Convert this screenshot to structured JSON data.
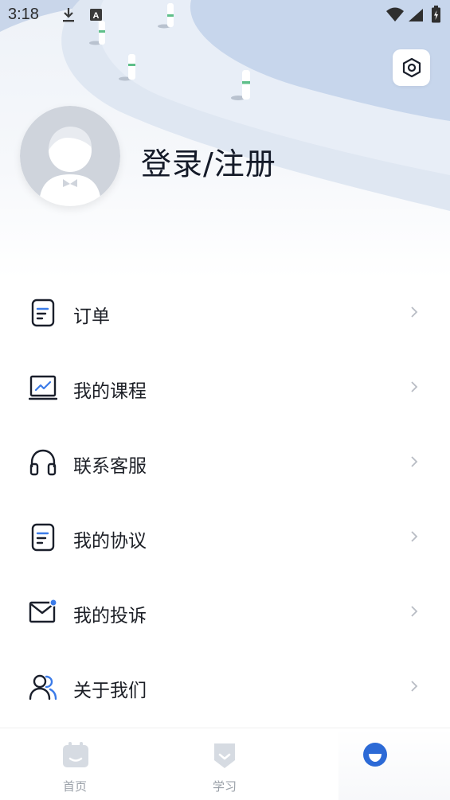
{
  "status_bar": {
    "time": "3:18",
    "icons": [
      "download-icon",
      "keyboard-a-icon",
      "wifi-icon",
      "signal-icon",
      "battery-charging-icon"
    ]
  },
  "header": {
    "settings_icon": "hexagon-settings-icon",
    "login_label": "登录/注册",
    "avatar_icon": "default-avatar-icon"
  },
  "menu": {
    "items": [
      {
        "label": "订单",
        "icon": "document-icon"
      },
      {
        "label": "我的课程",
        "icon": "chart-monitor-icon"
      },
      {
        "label": "联系客服",
        "icon": "headset-icon"
      },
      {
        "label": "我的协议",
        "icon": "document-icon"
      },
      {
        "label": "我的投诉",
        "icon": "mail-notification-icon"
      },
      {
        "label": "关于我们",
        "icon": "users-icon"
      }
    ]
  },
  "tabbar": {
    "tabs": [
      {
        "label": "首页",
        "icon": "calendar-home-icon"
      },
      {
        "label": "学习",
        "icon": "shield-study-icon"
      },
      {
        "label": "",
        "icon": "profile-face-icon"
      }
    ]
  },
  "colors": {
    "accent": "#2c6ad6",
    "text_primary": "#1c1f26",
    "tab_inactive": "#9aa0a8",
    "header_bg": "#eef2f8"
  }
}
